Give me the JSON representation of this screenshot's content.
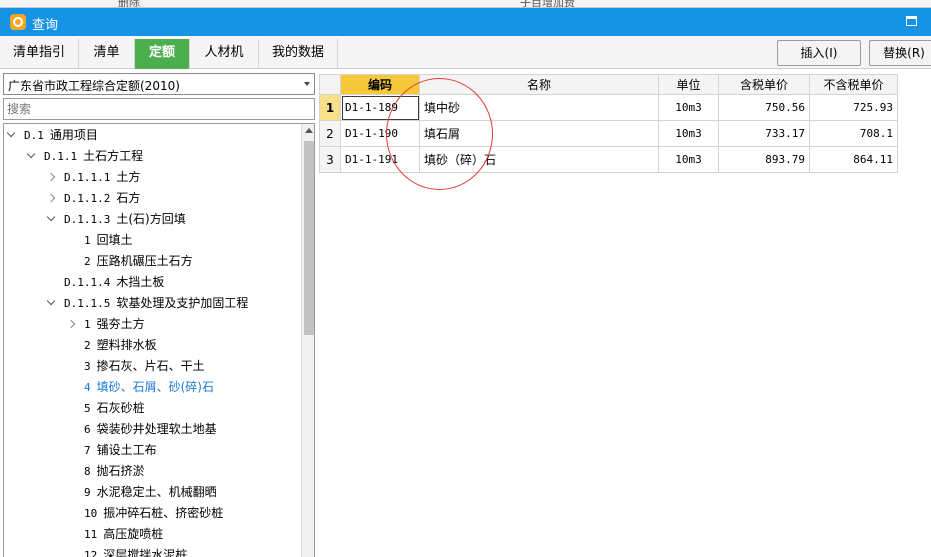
{
  "background_window": {
    "texts": [
      "删除",
      "子目增加费"
    ]
  },
  "window": {
    "title": "查询",
    "maximize_icon": "maximize-icon",
    "app_icon": "app-logo-icon"
  },
  "tabs": [
    {
      "label": "清单指引",
      "active": false
    },
    {
      "label": "清单",
      "active": false
    },
    {
      "label": "定额",
      "active": true
    },
    {
      "label": "人材机",
      "active": false
    },
    {
      "label": "我的数据",
      "active": false
    }
  ],
  "buttons": {
    "insert": "插入(I)",
    "replace": "替换(R)"
  },
  "library": {
    "selected": "广东省市政工程综合定额(2010)"
  },
  "search": {
    "placeholder": "搜索"
  },
  "tree": [
    {
      "code": "D.1",
      "label": "通用项目",
      "level": 0,
      "toggle": "expanded",
      "selected": false
    },
    {
      "code": "D.1.1",
      "label": "土石方工程",
      "level": 1,
      "toggle": "expanded",
      "selected": false
    },
    {
      "code": "D.1.1.1",
      "label": "土方",
      "level": 2,
      "toggle": "collapsed",
      "selected": false
    },
    {
      "code": "D.1.1.2",
      "label": "石方",
      "level": 2,
      "toggle": "collapsed",
      "selected": false
    },
    {
      "code": "D.1.1.3",
      "label": "土(石)方回填",
      "level": 2,
      "toggle": "expanded",
      "selected": false
    },
    {
      "code": "1",
      "label": "回填土",
      "level": 3,
      "toggle": "none",
      "selected": false
    },
    {
      "code": "2",
      "label": "压路机碾压土石方",
      "level": 3,
      "toggle": "none",
      "selected": false
    },
    {
      "code": "D.1.1.4",
      "label": "木挡土板",
      "level": 2,
      "toggle": "none",
      "selected": false
    },
    {
      "code": "D.1.1.5",
      "label": "软基处理及支护加固工程",
      "level": 2,
      "toggle": "expanded",
      "selected": false
    },
    {
      "code": "1",
      "label": "强夯土方",
      "level": 3,
      "toggle": "collapsed",
      "selected": false
    },
    {
      "code": "2",
      "label": "塑料排水板",
      "level": 3,
      "toggle": "none",
      "selected": false
    },
    {
      "code": "3",
      "label": "掺石灰、片石、干土",
      "level": 3,
      "toggle": "none",
      "selected": false
    },
    {
      "code": "4",
      "label": "填砂、石屑、砂(碎)石",
      "level": 3,
      "toggle": "none",
      "selected": true
    },
    {
      "code": "5",
      "label": "石灰砂桩",
      "level": 3,
      "toggle": "none",
      "selected": false
    },
    {
      "code": "6",
      "label": "袋装砂井处理软土地基",
      "level": 3,
      "toggle": "none",
      "selected": false
    },
    {
      "code": "7",
      "label": "铺设土工布",
      "level": 3,
      "toggle": "none",
      "selected": false
    },
    {
      "code": "8",
      "label": "抛石挤淤",
      "level": 3,
      "toggle": "none",
      "selected": false
    },
    {
      "code": "9",
      "label": "水泥稳定土、机械翻晒",
      "level": 3,
      "toggle": "none",
      "selected": false
    },
    {
      "code": "10",
      "label": "振冲碎石桩、挤密砂桩",
      "level": 3,
      "toggle": "none",
      "selected": false
    },
    {
      "code": "11",
      "label": "高压旋喷桩",
      "level": 3,
      "toggle": "none",
      "selected": false
    },
    {
      "code": "12",
      "label": "深层搅拌水泥桩",
      "level": 3,
      "toggle": "none",
      "selected": false
    }
  ],
  "table": {
    "columns": [
      "",
      "编码",
      "名称",
      "单位",
      "含税单价",
      "不含税单价"
    ],
    "rows": [
      {
        "no": "1",
        "code": "D1-1-189",
        "name": "填中砂",
        "unit": "10m3",
        "price_tax": "750.56",
        "price_notax": "725.93",
        "current": true
      },
      {
        "no": "2",
        "code": "D1-1-190",
        "name": "填石屑",
        "unit": "10m3",
        "price_tax": "733.17",
        "price_notax": "708.1",
        "current": false
      },
      {
        "no": "3",
        "code": "D1-1-191",
        "name": "填砂（碎）石",
        "unit": "10m3",
        "price_tax": "893.79",
        "price_notax": "864.11",
        "current": false
      }
    ]
  },
  "annotation": {
    "color": "#e23b3b"
  },
  "colors": {
    "titlebar": "#1793e6",
    "active_tab": "#4cae4c",
    "key_column": "#f5c93a",
    "tree_selected": "#1e78d2"
  }
}
